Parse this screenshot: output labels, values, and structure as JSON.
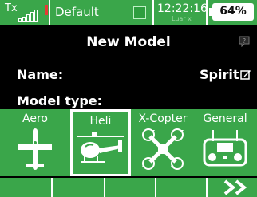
{
  "status_bar": {
    "tx_label": "Tx",
    "profile": "Default",
    "time": "12:22:16",
    "lua_text": "Luar x",
    "battery": "64%"
  },
  "page": {
    "title": "New Model"
  },
  "name_row": {
    "label": "Name:",
    "value": "Spirit"
  },
  "model_type": {
    "label": "Model type:",
    "items": [
      {
        "label": "Aero",
        "icon": "airplane-icon"
      },
      {
        "label": "Heli",
        "icon": "helicopter-icon",
        "selected": true
      },
      {
        "label": "X-Copter",
        "icon": "quadcopter-icon"
      },
      {
        "label": "General",
        "icon": "transmitter-icon"
      }
    ]
  },
  "colors": {
    "accent": "#3aa64a",
    "alert": "#e53935"
  }
}
